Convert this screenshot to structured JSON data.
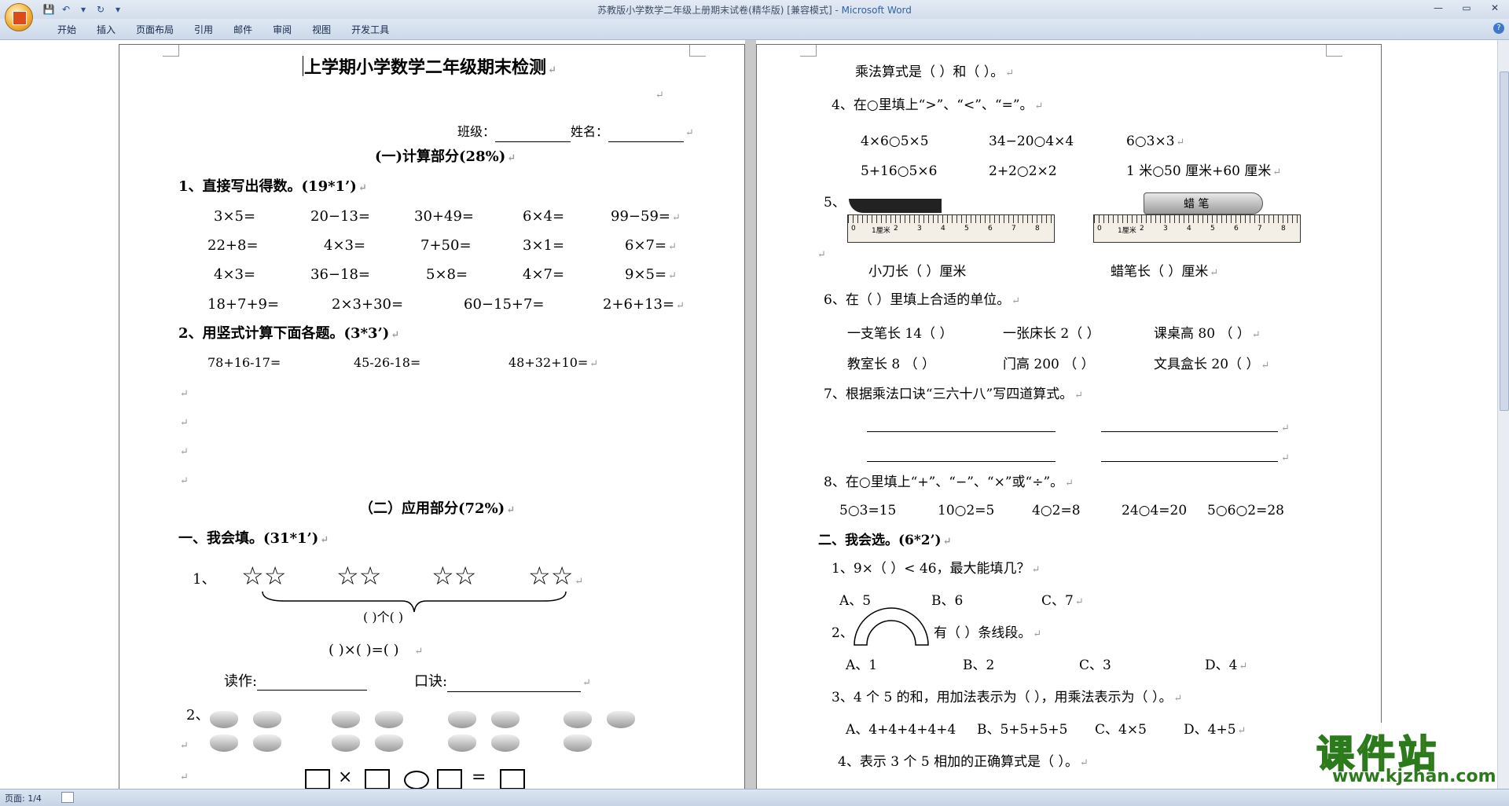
{
  "window": {
    "title": "苏教版小学数学二年级上册期末试卷(精华版) [兼容模式]",
    "app": " - Microsoft Word",
    "controls": [
      "—",
      "▭",
      "✕"
    ]
  },
  "qat": [
    "💾",
    "↶",
    "▾",
    "↻",
    "▾"
  ],
  "ribbon_tabs": [
    "开始",
    "插入",
    "页面布局",
    "引用",
    "邮件",
    "审阅",
    "视图",
    "开发工具"
  ],
  "status": {
    "page": "页面: 1/4"
  },
  "pilcrow": "↵",
  "page1": {
    "title": "上学期小学数学二年级期末检测",
    "class_label": "班级：",
    "name_label": "姓名：",
    "sec1": "(一)计算部分(28%)",
    "q1": "1、直接写出得数。(19*1’)",
    "r1": [
      "3×5=",
      "20−13=",
      "30+49=",
      "6×4=",
      "99−59="
    ],
    "r2": [
      "22+8=",
      "4×3=",
      "7+50=",
      "3×1=",
      "6×7="
    ],
    "r3": [
      "4×3=",
      "36−18=",
      "5×8=",
      "4×7=",
      "9×5="
    ],
    "r4": [
      "18+7+9=",
      "2×3+30=",
      "60−15+7=",
      "2+6+13="
    ],
    "q2": "2、用竖式计算下面各题。(3*3’)",
    "v": [
      "78+16-17=",
      "45-26-18=",
      "48+32+10="
    ],
    "sec2": "（二）应用部分(72%)",
    "p1": "一、我会填。(31*1’)",
    "f1_num": "1、",
    "stars": "☆☆",
    "brace_caption": "(   )个(   )",
    "mult_line": "(  )×(  )=(   )",
    "read_label": "读作:",
    "rhyme_label": "口诀:",
    "f2_num": "2、",
    "ops": [
      "×",
      "="
    ]
  },
  "page2": {
    "l1": "乘法算式是（              ）和（              ）。",
    "q4": "4、在○里填上“>”、“<”、“=”。",
    "c4a": [
      "4×6○5×5",
      "34−20○4×4",
      "6○3×3"
    ],
    "c4b": [
      "5+16○5×6",
      "2+2○2×2",
      "1 米○50 厘米+60 厘米"
    ],
    "q5_num": "5、",
    "ruler_digits": [
      "0",
      "1厘米",
      "2",
      "3",
      "4",
      "5",
      "6",
      "7",
      "8"
    ],
    "crayon_text": "蜡 笔",
    "knife_label": "小刀长（    ）厘米",
    "crayon_label": "蜡笔长（    ）厘米",
    "q6": "6、在（  ）里填上合适的单位。",
    "u1": [
      "一支笔长 14（    ）",
      "一张床长 2（    ）",
      "课桌高 80 （    ）"
    ],
    "u2": [
      "教室长 8 （    ）",
      "门高 200 （    ）",
      "文具盒长 20（    ）"
    ],
    "q7": "7、根据乘法口诀“三六十八”写四道算式。",
    "q8": "8、在○里填上“+”、“−”、“×”或“÷”。",
    "f8": [
      "5○3=15",
      "10○2=5",
      "4○2=8",
      "24○4=20",
      "5○6○2=28"
    ],
    "p2": "二、我会选。(6*2’)",
    "s1": "1、9×（    ）< 46，最大能填几？",
    "s1o": [
      "A、5",
      "B、6",
      "C、7"
    ],
    "s2_num": "2、",
    "s2_text": "有（    ）条线段。",
    "s2o": [
      "A、1",
      "B、2",
      "C、3",
      "D、4"
    ],
    "s3": "3、4 个 5 的和，用加法表示为（    ），用乘法表示为（    ）。",
    "s3o": [
      "A、4+4+4+4+4",
      "B、5+5+5+5",
      "C、4×5",
      "D、4+5"
    ],
    "s4": "4、表示 3 个 5 相加的正确算式是（      ）。"
  },
  "watermark": {
    "big": "课件站",
    "small": "www.kjzhan.com"
  }
}
